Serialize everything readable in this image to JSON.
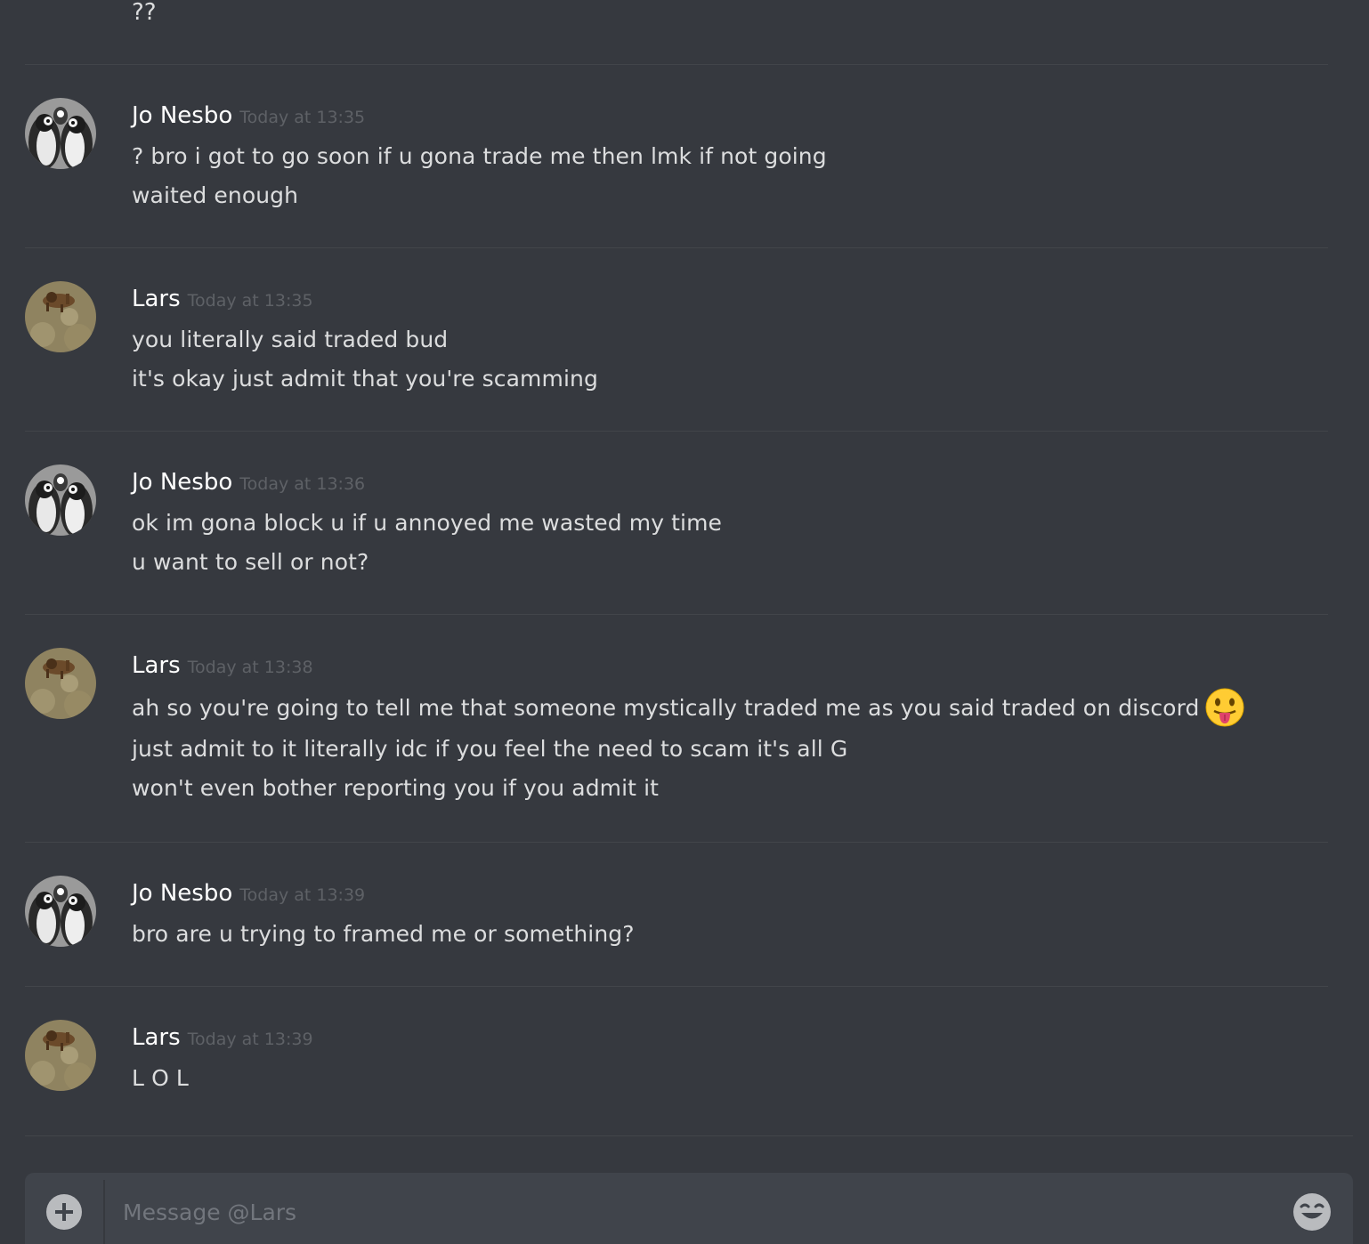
{
  "colors": {
    "background": "#36393f",
    "username": "#ffffff",
    "timestamp": "#5e6166",
    "text": "#dcddde",
    "divider": "#42454a",
    "composer": "#40444b"
  },
  "previous_fragment": "??",
  "messages": [
    {
      "author": "Jo Nesbo",
      "avatar": "penguins-avatar",
      "timestamp": "Today at 13:35",
      "lines": [
        "? bro i got to go soon if u gona trade me then lmk if not going",
        "waited enough"
      ]
    },
    {
      "author": "Lars",
      "avatar": "dog-avatar",
      "timestamp": "Today at 13:35",
      "lines": [
        "you literally said traded bud",
        "it's okay just admit that you're scamming"
      ]
    },
    {
      "author": "Jo Nesbo",
      "avatar": "penguins-avatar",
      "timestamp": "Today at 13:36",
      "lines": [
        "ok im gona block u if u annoyed me wasted my time",
        "u want to sell or not?"
      ]
    },
    {
      "author": "Lars",
      "avatar": "dog-avatar",
      "timestamp": "Today at 13:38",
      "lines": [
        "ah so you're going to tell me that someone mystically traded me as you said traded on discord",
        "just admit to it literally idc if you feel the need to scam it's all G",
        "won't even bother reporting you if you admit it"
      ],
      "emoji": "tongue-out-emoji"
    },
    {
      "author": "Jo Nesbo",
      "avatar": "penguins-avatar",
      "timestamp": "Today at 13:39",
      "lines": [
        "bro are u trying to framed me or something?"
      ]
    },
    {
      "author": "Lars",
      "avatar": "dog-avatar",
      "timestamp": "Today at 13:39",
      "lines": [
        "L O L"
      ]
    }
  ],
  "composer": {
    "placeholder": "Message @Lars",
    "add_icon": "plus-circle-icon",
    "emoji_icon": "emoji-picker-icon"
  }
}
